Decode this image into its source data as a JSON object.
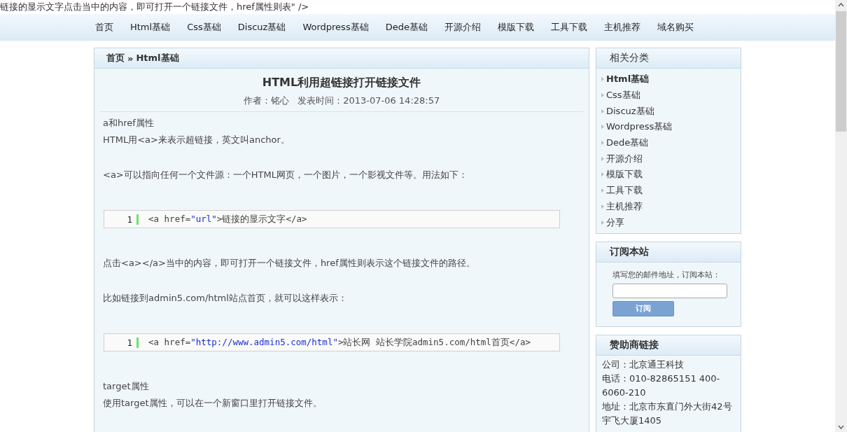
{
  "top_text": "链接的显示文字点击当中的内容，即可打开一个链接文件，href属性则表\" />",
  "nav": {
    "items": [
      "首页",
      "Html基础",
      "Css基础",
      "Discuz基础",
      "Wordpress基础",
      "Dede基础",
      "开源介绍",
      "模版下载",
      "工具下载",
      "主机推荐",
      "域名购买"
    ]
  },
  "breadcrumb": {
    "home": "首页",
    "separator": "»",
    "current": "Html基础"
  },
  "article": {
    "title": "HTML利用超链接打开链接文件",
    "meta": "作者：铭心   发表时间：2013-07-06 14:28:57",
    "blocks": [
      {
        "kind": "subhead",
        "text": "a和href属性"
      },
      {
        "kind": "para",
        "text": "HTML用<a>来表示超链接，英文叫anchor。"
      },
      {
        "kind": "para",
        "text": "<a>可以指向任何一个文件源：一个HTML网页，一个图片，一个影视文件等。用法如下："
      },
      {
        "kind": "code",
        "line_number": "1",
        "tokens": [
          {
            "kind": "plain",
            "text": "<a href="
          },
          {
            "kind": "string",
            "text": "\"url\""
          },
          {
            "kind": "plain",
            "text": ">链接的显示文字</a>"
          }
        ]
      },
      {
        "kind": "para",
        "text": "点击<a></a>当中的内容，即可打开一个链接文件，href属性则表示这个链接文件的路径。"
      },
      {
        "kind": "para",
        "text": "比如链接到admin5.com/html站点首页，就可以这样表示："
      },
      {
        "kind": "code",
        "line_number": "1",
        "tokens": [
          {
            "kind": "plain",
            "text": "<a href="
          },
          {
            "kind": "string",
            "text": "\"http://www.admin5.com/html\""
          },
          {
            "kind": "plain",
            "text": ">站长网 站长学院admin5.com/html首页</a>"
          }
        ]
      },
      {
        "kind": "subhead",
        "text": "target属性"
      },
      {
        "kind": "para",
        "text": "使用target属性，可以在一个新窗口里打开链接文件。"
      }
    ]
  },
  "categories": {
    "title": "相关分类",
    "items": [
      {
        "label": "Html基础",
        "selected": true
      },
      {
        "label": "Css基础",
        "selected": false
      },
      {
        "label": "Discuz基础",
        "selected": false
      },
      {
        "label": "Wordpress基础",
        "selected": false
      },
      {
        "label": "Dede基础",
        "selected": false
      },
      {
        "label": "开源介绍",
        "selected": false
      },
      {
        "label": "模版下载",
        "selected": false
      },
      {
        "label": "工具下载",
        "selected": false
      },
      {
        "label": "主机推荐",
        "selected": false
      },
      {
        "label": "分享",
        "selected": false
      }
    ]
  },
  "subscribe": {
    "title": "订阅本站",
    "prompt": "填写您的邮件地址，订阅本站：",
    "button": "订阅"
  },
  "sponsor": {
    "title": "赞助商链接",
    "lines": [
      "公司：北京通王科技",
      "电话：010-82865151 400-6060-210",
      "地址：北京市东直门外大街42号宇飞大厦1405"
    ]
  }
}
